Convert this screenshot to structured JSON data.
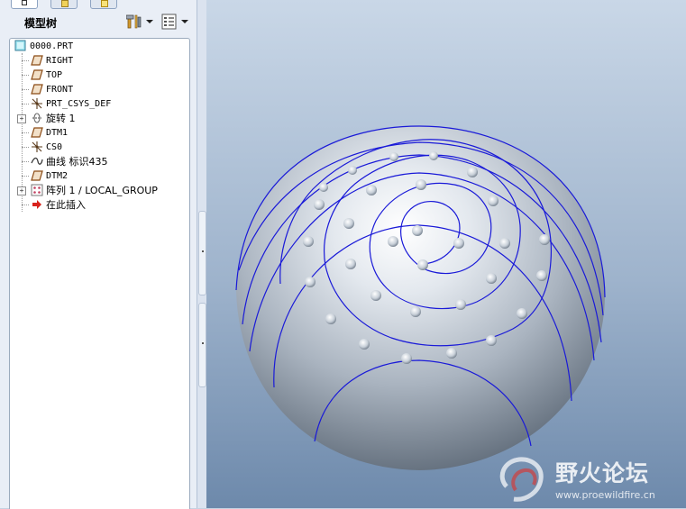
{
  "panel": {
    "title": "模型树"
  },
  "tree": {
    "items": [
      {
        "label": "0000.PRT",
        "icon": "part-icon"
      },
      {
        "label": "RIGHT",
        "icon": "datum-plane-icon"
      },
      {
        "label": "TOP",
        "icon": "datum-plane-icon"
      },
      {
        "label": "FRONT",
        "icon": "datum-plane-icon"
      },
      {
        "label": "PRT_CSYS_DEF",
        "icon": "csys-icon"
      },
      {
        "label": "旋转 1",
        "icon": "revolve-icon"
      },
      {
        "label": "DTM1",
        "icon": "datum-plane-icon"
      },
      {
        "label": "CS0",
        "icon": "csys-icon"
      },
      {
        "label": "曲线 标识435",
        "icon": "curve-icon"
      },
      {
        "label": "DTM2",
        "icon": "datum-plane-icon"
      },
      {
        "label": "阵列 1 / LOCAL_GROUP",
        "icon": "pattern-icon"
      },
      {
        "label": "在此插入",
        "icon": "insert-here-arrow-icon"
      }
    ]
  },
  "watermark": {
    "title": "野火论坛",
    "url": "www.proewildfire.cn"
  },
  "colors": {
    "curve": "#1a1ad8",
    "accent": "#e0312a"
  }
}
